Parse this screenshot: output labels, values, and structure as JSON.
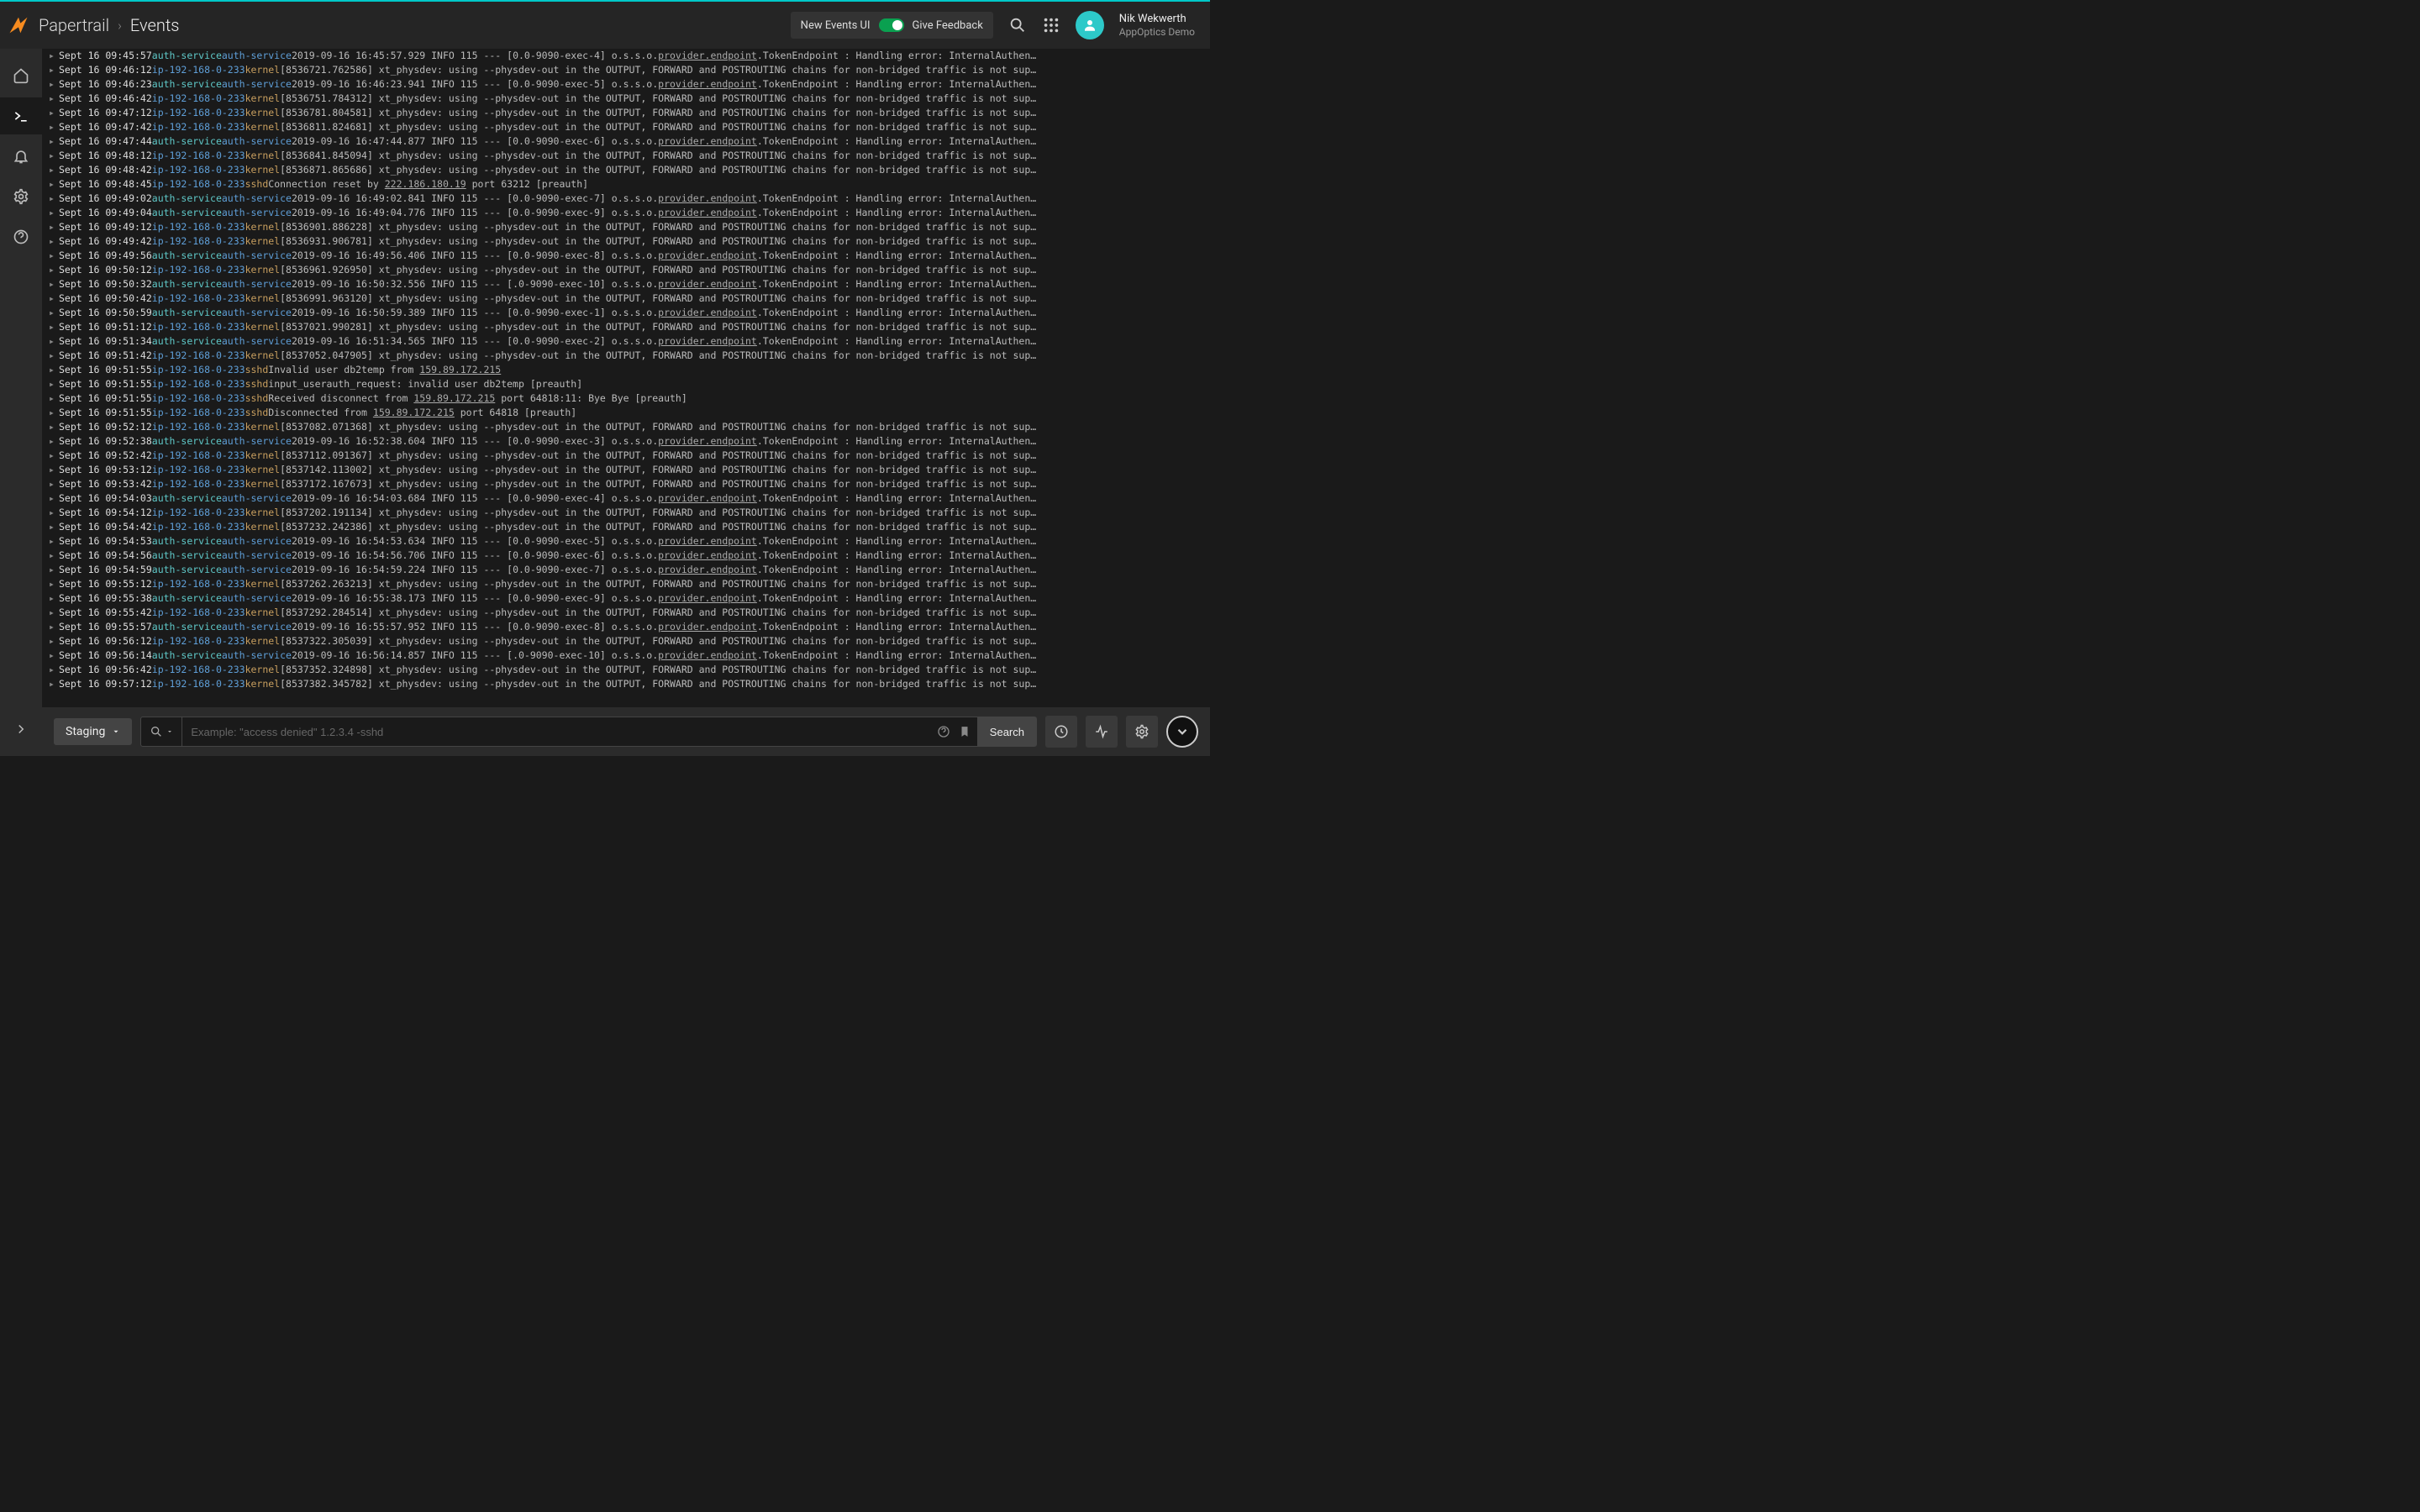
{
  "header": {
    "product": "Papertrail",
    "section": "Events",
    "new_ui_label": "New Events UI",
    "feedback_label": "Give Feedback"
  },
  "user": {
    "name": "Nik Wekwerth",
    "org": "AppOptics Demo"
  },
  "search": {
    "env": "Staging",
    "placeholder": "Example: \"access denied\" 1.2.3.4 -sshd",
    "button": "Search"
  },
  "log_templates": {
    "kernel_physdev": "xt_physdev: using --physdev-out in the OUTPUT, FORWARD and POSTROUTING chains for non-bridged traffic is not sup…",
    "auth_token_prefix": "o.s.s.o.",
    "auth_token_link": "provider.endpoint",
    "auth_token_suffix": ".TokenEndpoint : Handling error: InternalAuthen…"
  },
  "logs": [
    {
      "t": "Sept 16 09:45:57",
      "host": "auth-service",
      "proc": "auth-service",
      "pre": "2019-09-16 16:45:57.929 INFO 115 --- [0.0-9090-exec-4] ",
      "kind": "auth"
    },
    {
      "t": "Sept 16 09:46:12",
      "host": "ip-192-168-0-233",
      "proc": "kernel",
      "pre": "[8536721.762586] ",
      "kind": "kernel"
    },
    {
      "t": "Sept 16 09:46:23",
      "host": "auth-service",
      "proc": "auth-service",
      "pre": "2019-09-16 16:46:23.941 INFO 115 --- [0.0-9090-exec-5] ",
      "kind": "auth"
    },
    {
      "t": "Sept 16 09:46:42",
      "host": "ip-192-168-0-233",
      "proc": "kernel",
      "pre": "[8536751.784312] ",
      "kind": "kernel"
    },
    {
      "t": "Sept 16 09:47:12",
      "host": "ip-192-168-0-233",
      "proc": "kernel",
      "pre": "[8536781.804581] ",
      "kind": "kernel"
    },
    {
      "t": "Sept 16 09:47:42",
      "host": "ip-192-168-0-233",
      "proc": "kernel",
      "pre": "[8536811.824681] ",
      "kind": "kernel"
    },
    {
      "t": "Sept 16 09:47:44",
      "host": "auth-service",
      "proc": "auth-service",
      "pre": "2019-09-16 16:47:44.877 INFO 115 --- [0.0-9090-exec-6] ",
      "kind": "auth"
    },
    {
      "t": "Sept 16 09:48:12",
      "host": "ip-192-168-0-233",
      "proc": "kernel",
      "pre": "[8536841.845094] ",
      "kind": "kernel"
    },
    {
      "t": "Sept 16 09:48:42",
      "host": "ip-192-168-0-233",
      "proc": "kernel",
      "pre": "[8536871.865686] ",
      "kind": "kernel"
    },
    {
      "t": "Sept 16 09:48:45",
      "host": "ip-192-168-0-233",
      "proc": "sshd",
      "raw": "Connection reset by <u>222.186.180.19</u> port 63212 [preauth]",
      "kind": "sshd"
    },
    {
      "t": "Sept 16 09:49:02",
      "host": "auth-service",
      "proc": "auth-service",
      "pre": "2019-09-16 16:49:02.841 INFO 115 --- [0.0-9090-exec-7] ",
      "kind": "auth"
    },
    {
      "t": "Sept 16 09:49:04",
      "host": "auth-service",
      "proc": "auth-service",
      "pre": "2019-09-16 16:49:04.776 INFO 115 --- [0.0-9090-exec-9] ",
      "kind": "auth"
    },
    {
      "t": "Sept 16 09:49:12",
      "host": "ip-192-168-0-233",
      "proc": "kernel",
      "pre": "[8536901.886228] ",
      "kind": "kernel"
    },
    {
      "t": "Sept 16 09:49:42",
      "host": "ip-192-168-0-233",
      "proc": "kernel",
      "pre": "[8536931.906781] ",
      "kind": "kernel"
    },
    {
      "t": "Sept 16 09:49:56",
      "host": "auth-service",
      "proc": "auth-service",
      "pre": "2019-09-16 16:49:56.406 INFO 115 --- [0.0-9090-exec-8] ",
      "kind": "auth"
    },
    {
      "t": "Sept 16 09:50:12",
      "host": "ip-192-168-0-233",
      "proc": "kernel",
      "pre": "[8536961.926950] ",
      "kind": "kernel"
    },
    {
      "t": "Sept 16 09:50:32",
      "host": "auth-service",
      "proc": "auth-service",
      "pre": "2019-09-16 16:50:32.556 INFO 115 --- [.0-9090-exec-10] ",
      "kind": "auth"
    },
    {
      "t": "Sept 16 09:50:42",
      "host": "ip-192-168-0-233",
      "proc": "kernel",
      "pre": "[8536991.963120] ",
      "kind": "kernel"
    },
    {
      "t": "Sept 16 09:50:59",
      "host": "auth-service",
      "proc": "auth-service",
      "pre": "2019-09-16 16:50:59.389 INFO 115 --- [0.0-9090-exec-1] ",
      "kind": "auth"
    },
    {
      "t": "Sept 16 09:51:12",
      "host": "ip-192-168-0-233",
      "proc": "kernel",
      "pre": "[8537021.990281] ",
      "kind": "kernel"
    },
    {
      "t": "Sept 16 09:51:34",
      "host": "auth-service",
      "proc": "auth-service",
      "pre": "2019-09-16 16:51:34.565 INFO 115 --- [0.0-9090-exec-2] ",
      "kind": "auth"
    },
    {
      "t": "Sept 16 09:51:42",
      "host": "ip-192-168-0-233",
      "proc": "kernel",
      "pre": "[8537052.047905] ",
      "kind": "kernel"
    },
    {
      "t": "Sept 16 09:51:55",
      "host": "ip-192-168-0-233",
      "proc": "sshd",
      "raw": "Invalid user db2temp from <u>159.89.172.215</u>",
      "kind": "sshd"
    },
    {
      "t": "Sept 16 09:51:55",
      "host": "ip-192-168-0-233",
      "proc": "sshd",
      "raw": "input_userauth_request: invalid user db2temp [preauth]",
      "kind": "sshd"
    },
    {
      "t": "Sept 16 09:51:55",
      "host": "ip-192-168-0-233",
      "proc": "sshd",
      "raw": "Received disconnect from <u>159.89.172.215</u> port 64818:11: Bye Bye [preauth]",
      "kind": "sshd"
    },
    {
      "t": "Sept 16 09:51:55",
      "host": "ip-192-168-0-233",
      "proc": "sshd",
      "raw": "Disconnected from <u>159.89.172.215</u> port 64818 [preauth]",
      "kind": "sshd"
    },
    {
      "t": "Sept 16 09:52:12",
      "host": "ip-192-168-0-233",
      "proc": "kernel",
      "pre": "[8537082.071368] ",
      "kind": "kernel"
    },
    {
      "t": "Sept 16 09:52:38",
      "host": "auth-service",
      "proc": "auth-service",
      "pre": "2019-09-16 16:52:38.604 INFO 115 --- [0.0-9090-exec-3] ",
      "kind": "auth"
    },
    {
      "t": "Sept 16 09:52:42",
      "host": "ip-192-168-0-233",
      "proc": "kernel",
      "pre": "[8537112.091367] ",
      "kind": "kernel"
    },
    {
      "t": "Sept 16 09:53:12",
      "host": "ip-192-168-0-233",
      "proc": "kernel",
      "pre": "[8537142.113002] ",
      "kind": "kernel"
    },
    {
      "t": "Sept 16 09:53:42",
      "host": "ip-192-168-0-233",
      "proc": "kernel",
      "pre": "[8537172.167673] ",
      "kind": "kernel"
    },
    {
      "t": "Sept 16 09:54:03",
      "host": "auth-service",
      "proc": "auth-service",
      "pre": "2019-09-16 16:54:03.684 INFO 115 --- [0.0-9090-exec-4] ",
      "kind": "auth"
    },
    {
      "t": "Sept 16 09:54:12",
      "host": "ip-192-168-0-233",
      "proc": "kernel",
      "pre": "[8537202.191134] ",
      "kind": "kernel"
    },
    {
      "t": "Sept 16 09:54:42",
      "host": "ip-192-168-0-233",
      "proc": "kernel",
      "pre": "[8537232.242386] ",
      "kind": "kernel"
    },
    {
      "t": "Sept 16 09:54:53",
      "host": "auth-service",
      "proc": "auth-service",
      "pre": "2019-09-16 16:54:53.634 INFO 115 --- [0.0-9090-exec-5] ",
      "kind": "auth"
    },
    {
      "t": "Sept 16 09:54:56",
      "host": "auth-service",
      "proc": "auth-service",
      "pre": "2019-09-16 16:54:56.706 INFO 115 --- [0.0-9090-exec-6] ",
      "kind": "auth"
    },
    {
      "t": "Sept 16 09:54:59",
      "host": "auth-service",
      "proc": "auth-service",
      "pre": "2019-09-16 16:54:59.224 INFO 115 --- [0.0-9090-exec-7] ",
      "kind": "auth"
    },
    {
      "t": "Sept 16 09:55:12",
      "host": "ip-192-168-0-233",
      "proc": "kernel",
      "pre": "[8537262.263213] ",
      "kind": "kernel"
    },
    {
      "t": "Sept 16 09:55:38",
      "host": "auth-service",
      "proc": "auth-service",
      "pre": "2019-09-16 16:55:38.173 INFO 115 --- [0.0-9090-exec-9] ",
      "kind": "auth"
    },
    {
      "t": "Sept 16 09:55:42",
      "host": "ip-192-168-0-233",
      "proc": "kernel",
      "pre": "[8537292.284514] ",
      "kind": "kernel"
    },
    {
      "t": "Sept 16 09:55:57",
      "host": "auth-service",
      "proc": "auth-service",
      "pre": "2019-09-16 16:55:57.952 INFO 115 --- [0.0-9090-exec-8] ",
      "kind": "auth"
    },
    {
      "t": "Sept 16 09:56:12",
      "host": "ip-192-168-0-233",
      "proc": "kernel",
      "pre": "[8537322.305039] ",
      "kind": "kernel"
    },
    {
      "t": "Sept 16 09:56:14",
      "host": "auth-service",
      "proc": "auth-service",
      "pre": "2019-09-16 16:56:14.857 INFO 115 --- [.0-9090-exec-10] ",
      "kind": "auth"
    },
    {
      "t": "Sept 16 09:56:42",
      "host": "ip-192-168-0-233",
      "proc": "kernel",
      "pre": "[8537352.324898] ",
      "kind": "kernel"
    },
    {
      "t": "Sept 16 09:57:12",
      "host": "ip-192-168-0-233",
      "proc": "kernel",
      "pre": "[8537382.345782] ",
      "kind": "kernel"
    }
  ]
}
